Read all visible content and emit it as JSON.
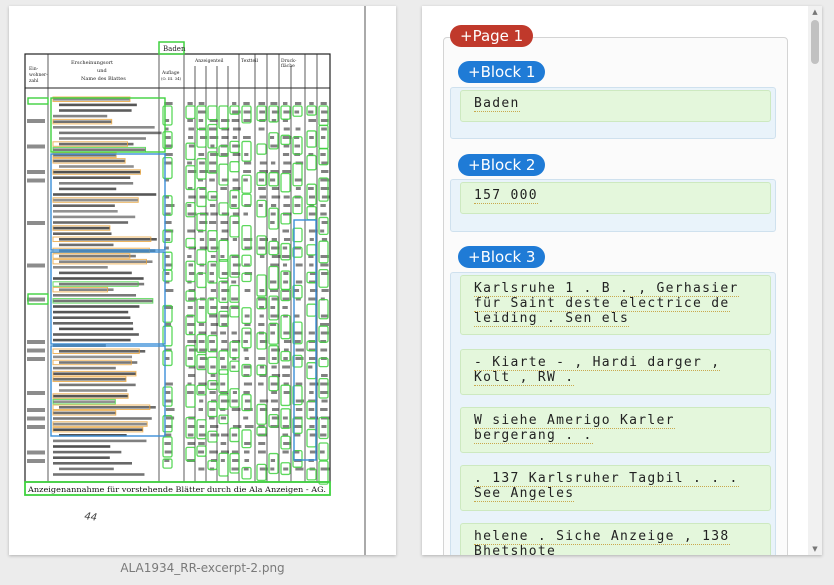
{
  "document": {
    "filename": "ALA1934_RR-excerpt-2.png",
    "header": {
      "col_residents": "Ein-\nwohner-\nzahl",
      "col_place": "Erscheinungsort\nund\nName des Blattes",
      "col_edition": "Auflage\n(O. III. 34)",
      "col_ads": "Anzeigenteil",
      "col_text": "Textteil",
      "col_print": "Druck-\nfläche",
      "col_rates": "Ausschnittpreise"
    },
    "badge_text": "Baden",
    "footer_text": "Anzeigenannahme für vorstehende Blätter durch die Ala Anzeigen - AG.",
    "handwriting": "44"
  },
  "panel": {
    "page_label": "+Page 1",
    "blocks": [
      {
        "label": "+Block 1",
        "lines": [
          "Baden"
        ]
      },
      {
        "label": "+Block 2",
        "lines": [
          "157 000"
        ]
      },
      {
        "label": "+Block 3",
        "lines": [
          "Karlsruhe 1 . B . , Gerhasier für Saint deste electrice de leiding . Sen els",
          "- Kiarte - , Hardi darger , Kolt , RW .",
          "W siehe Amerigo Karler bergerang . .",
          ". 137 Karlsruher Tagbil . . . See Angeles",
          "helene . Siche Anzeige , 138 Bhetshote"
        ]
      }
    ]
  },
  "colors": {
    "page_pill": "#c0392b",
    "block_pill": "#1f7bd6",
    "block_bg": "#e9f3fa",
    "line_bg": "#e4f7dc",
    "overlay_green": "#3fd13f",
    "overlay_blue": "#3a8fd8",
    "overlay_orange": "#e8a33a"
  }
}
